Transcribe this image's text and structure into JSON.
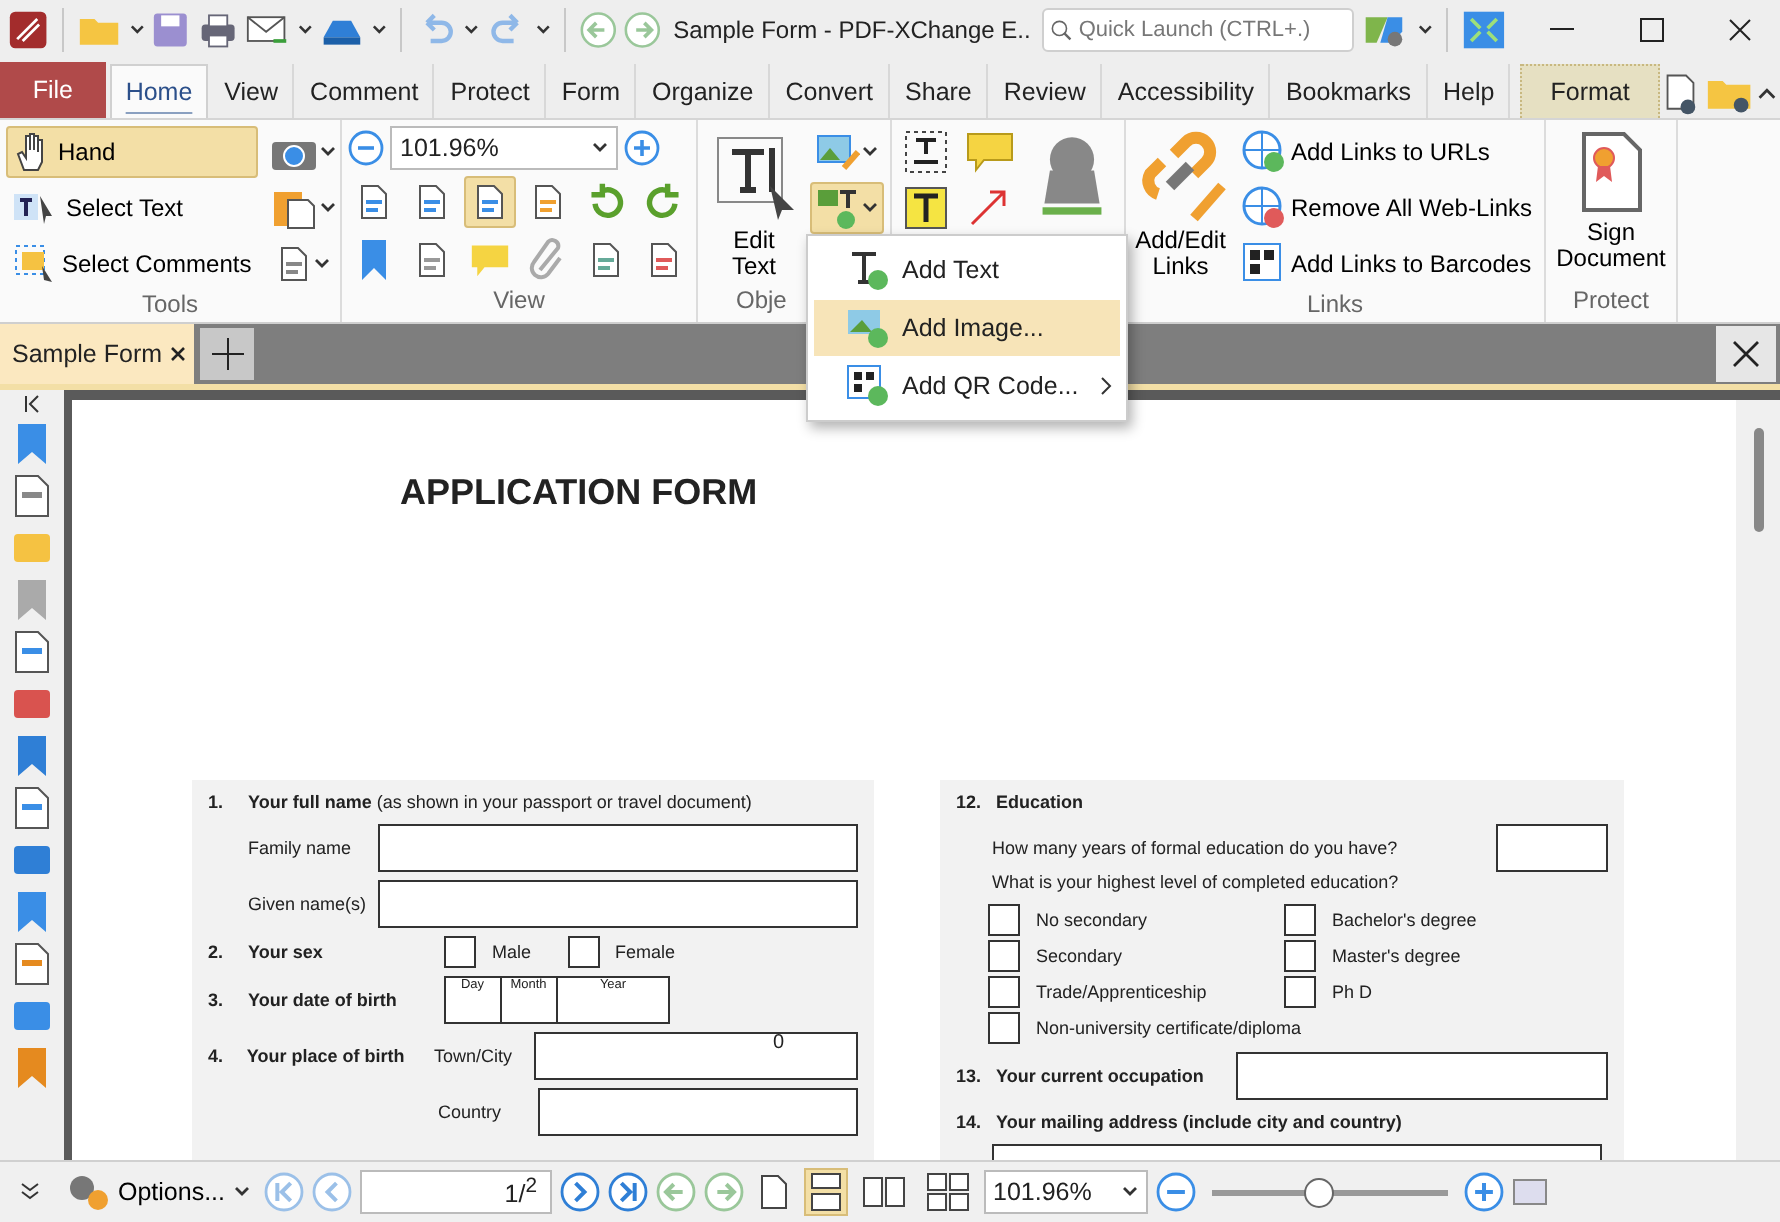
{
  "window": {
    "title": "Sample Form - PDF-XChange E..",
    "quick_launch": {
      "placeholder": "Quick Launch (CTRL+.)"
    }
  },
  "ribbon_tabs": [
    {
      "label": "File",
      "kind": "file",
      "selected": false
    },
    {
      "label": "Home",
      "kind": "tab",
      "selected": true
    },
    {
      "label": "View",
      "kind": "tab",
      "selected": false
    },
    {
      "label": "Comment",
      "kind": "tab",
      "selected": false
    },
    {
      "label": "Protect",
      "kind": "tab",
      "selected": false
    },
    {
      "label": "Form",
      "kind": "tab",
      "selected": false
    },
    {
      "label": "Organize",
      "kind": "tab",
      "selected": false
    },
    {
      "label": "Convert",
      "kind": "tab",
      "selected": false
    },
    {
      "label": "Share",
      "kind": "tab",
      "selected": false
    },
    {
      "label": "Review",
      "kind": "tab",
      "selected": false
    },
    {
      "label": "Accessibility",
      "kind": "tab",
      "selected": false
    },
    {
      "label": "Bookmarks",
      "kind": "tab",
      "selected": false
    },
    {
      "label": "Help",
      "kind": "tab",
      "selected": false
    },
    {
      "label": "Format",
      "kind": "context",
      "selected": false
    }
  ],
  "tools": {
    "label": "Tools",
    "items": [
      {
        "label": "Hand",
        "selected": true
      },
      {
        "label": "Select Text",
        "selected": false
      },
      {
        "label": "Select Comments",
        "selected": false
      }
    ]
  },
  "view": {
    "label": "View",
    "zoom": "101.96%"
  },
  "objects": {
    "label": "Obje",
    "edit_text": "Edit Text"
  },
  "links": {
    "label": "Links",
    "add_edit": "Add/Edit Links",
    "items": [
      "Add Links to URLs",
      "Remove All Web-Links",
      "Add Links to Barcodes"
    ]
  },
  "protect": {
    "label": "Protect",
    "sign": "Sign Document"
  },
  "dropdown_menu": [
    {
      "label": "Add Text",
      "selected": false,
      "submenu": false
    },
    {
      "label": "Add Image...",
      "selected": true,
      "submenu": false
    },
    {
      "label": "Add QR Code...",
      "selected": false,
      "submenu": true
    }
  ],
  "document_tabs": [
    {
      "label": "Sample Form",
      "selected": true
    }
  ],
  "form": {
    "title": "APPLICATION FORM",
    "left": [
      {
        "number": "1.",
        "heading": "**Your full name** (as shown in your passport or travel document)",
        "fields": [
          {
            "label": "Family name"
          },
          {
            "label": "Given name(s)"
          }
        ]
      },
      {
        "number": "2.",
        "heading": "**Your sex**",
        "checkboxes": [
          {
            "label": "Male",
            "checked": false
          },
          {
            "label": "Female",
            "checked": false
          }
        ]
      },
      {
        "number": "3.",
        "heading": "**Your date of birth**",
        "date_parts": [
          "Day",
          "Month",
          "Year"
        ]
      },
      {
        "number": "4.",
        "heading": "**Your place of birth**",
        "fields": [
          {
            "label": "Town/City",
            "value": "0"
          },
          {
            "label": "Country"
          }
        ]
      }
    ],
    "education": {
      "number": "12.",
      "heading": "Education",
      "years_question": "How many years of formal education do you have?",
      "level_question": "What is your highest level of completed education?",
      "options": [
        {
          "label": "No secondary",
          "checked": false
        },
        {
          "label": "Secondary",
          "checked": false
        },
        {
          "label": "Trade/Apprenticeship",
          "checked": false
        },
        {
          "label": "Non-university certificate/diploma",
          "checked": false
        },
        {
          "label": "Bachelor's degree",
          "checked": false
        },
        {
          "label": "Master's degree",
          "checked": false
        },
        {
          "label": "Ph D",
          "checked": false
        }
      ]
    },
    "occupation": {
      "number": "13.",
      "heading": "Your current occupation"
    },
    "address": {
      "number": "14.",
      "heading": "Your mailing address (include city and country)"
    }
  },
  "status_bar": {
    "options": "Options...",
    "page": "1/$^{2}$",
    "zoom": "101.96%",
    "zoom_slider": {
      "level": 0.45
    }
  }
}
